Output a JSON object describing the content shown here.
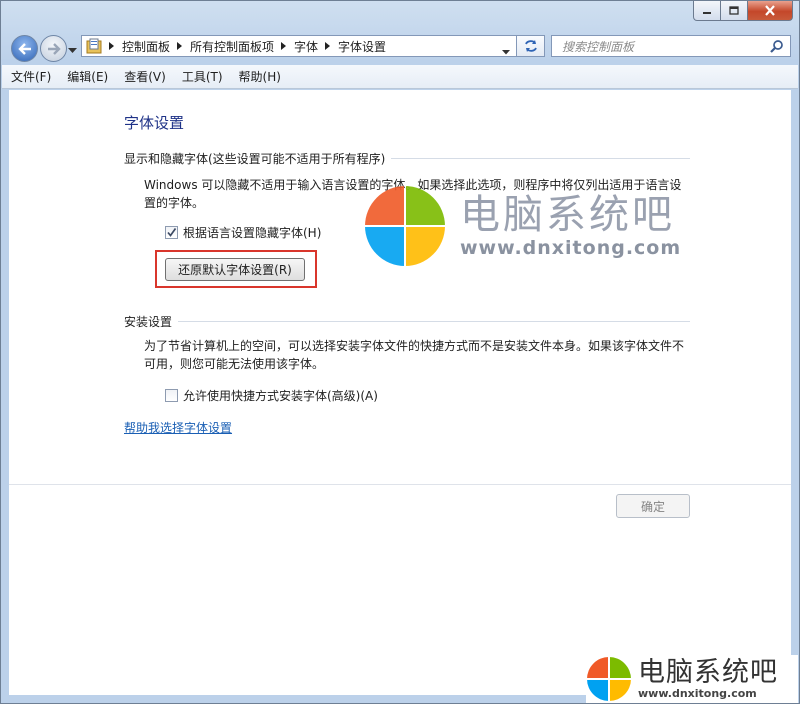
{
  "address": {
    "crumbs": [
      "控制面板",
      "所有控制面板项",
      "字体",
      "字体设置"
    ]
  },
  "search": {
    "placeholder": "搜索控制面板"
  },
  "menu": [
    "文件(F)",
    "编辑(E)",
    "查看(V)",
    "工具(T)",
    "帮助(H)"
  ],
  "main": {
    "title": "字体设置",
    "group1": {
      "header": "显示和隐藏字体(这些设置可能不适用于所有程序)",
      "desc_line1": "Windows 可以隐藏不适用于输入语言设置的字体。如果选择此选项，则程序中将仅列出适用于语言设",
      "desc_line2": "置的字体。",
      "checkbox_label": "根据语言设置隐藏字体(H)",
      "checkbox_checked": true,
      "restore_button": "还原默认字体设置(R)"
    },
    "group2": {
      "header": "安装设置",
      "desc_line1": "为了节省计算机上的空间，可以选择安装字体文件的快捷方式而不是安装文件本身。如果该字体文件不",
      "desc_line2": "可用，则您可能无法使用该字体。",
      "checkbox_label": "允许使用快捷方式安装字体(高级)(A)",
      "checkbox_checked": false
    },
    "help_link": "帮助我选择字体设置",
    "ok_button": "确定"
  },
  "watermark": {
    "name": "电脑系统吧",
    "url": "www.dnxitong.com"
  },
  "colors": {
    "title_blue": "#1e3287",
    "link_blue": "#1a5fb4",
    "highlight_red": "#d9362c",
    "logo_red": "#f05a28",
    "logo_green": "#7cbb00",
    "logo_blue": "#00a1f1",
    "logo_yellow": "#ffbb00"
  }
}
